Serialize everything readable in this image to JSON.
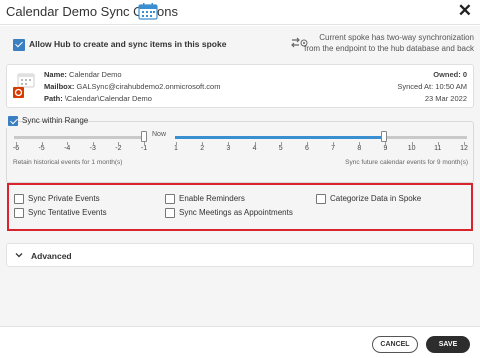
{
  "dialog": {
    "title": "Calendar Demo Sync Options",
    "close_glyph": "✕"
  },
  "allow": {
    "checked": true,
    "label": "Allow Hub to create and sync items in this spoke",
    "sync_note_line1": "Current spoke has two-way synchronization",
    "sync_note_line2": "from the endpoint to the hub database and back"
  },
  "spoke": {
    "name_label": "Name:",
    "name_value": "Calendar Demo",
    "mailbox_label": "Mailbox:",
    "mailbox_value": "GALSync@cirahubdemo2.onmicrosoft.com",
    "path_label": "Path:",
    "path_value": "\\Calendar\\Calendar Demo",
    "owned": "Owned: 0",
    "synced_at": "Synced At: 10:50 AM",
    "synced_date": "23 Mar 2022",
    "icon": "outlook-calendar-icon"
  },
  "range": {
    "checked": true,
    "label": "Sync within Range",
    "now_label": "Now",
    "past_ticks": [
      "-6",
      "-5",
      "-4",
      "-3",
      "-2",
      "-1"
    ],
    "future_ticks": [
      "1",
      "2",
      "3",
      "4",
      "5",
      "6",
      "7",
      "8",
      "9",
      "10",
      "11",
      "12"
    ],
    "past_months": 1,
    "future_months": 9,
    "retain_text": "Retain historical events for 1 month(s)",
    "future_text": "Sync future calendar events for 9 month(s)"
  },
  "options": [
    {
      "label": "Sync Private Events",
      "checked": false
    },
    {
      "label": "Enable Reminders",
      "checked": false
    },
    {
      "label": "Categorize Data in Spoke",
      "checked": false
    },
    {
      "label": "Sync Tentative Events",
      "checked": false
    },
    {
      "label": "Sync Meetings as Appointments",
      "checked": false
    }
  ],
  "advanced": {
    "label": "Advanced"
  },
  "footer": {
    "cancel_label": "CANCEL",
    "save_label": "SAVE"
  },
  "colors": {
    "accent": "#3a7fc1",
    "slider_active": "#3a8fd1",
    "highlight_border": "#d9232d",
    "save_bg": "#2d2d2d"
  }
}
